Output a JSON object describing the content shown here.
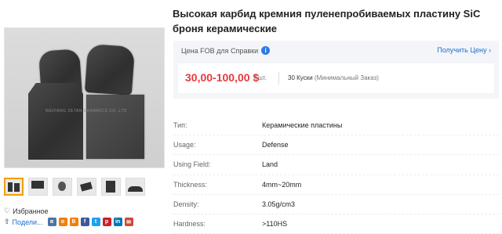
{
  "product": {
    "title": "Высокая карбид кремния пуленепробиваемых пластину SiC броня керамические",
    "image_watermark": "WEIFANG ZETAN CERAMICS CO.,LTD",
    "zoom_glyph": "⊕"
  },
  "price_box": {
    "header_label": "Цена FOB для Справки",
    "get_price_label": "Получить Цену",
    "price": "30,00-100,00 $",
    "unit": "/ шт.",
    "moq_value": "30 Куски",
    "moq_note": "(Минимальный Заказ)"
  },
  "specs": [
    {
      "key": "Тип:",
      "value": "Керамические пластины"
    },
    {
      "key": "Usage:",
      "value": "Defense"
    },
    {
      "key": "Using Field:",
      "value": "Land"
    },
    {
      "key": "Thickness:",
      "value": "4mm~20mm"
    },
    {
      "key": "Density:",
      "value": "3.05g/cm3"
    },
    {
      "key": "Hardness:",
      "value": ">110HS"
    }
  ],
  "actions": {
    "favorite_label": "Избранное",
    "share_label": "Подели...",
    "social_icons": [
      "vk-icon",
      "odnoklassniki-icon",
      "blogger-icon",
      "facebook-icon",
      "twitter-icon",
      "pinterest-icon",
      "linkedin-icon",
      "email-icon"
    ]
  },
  "colors": {
    "price": "#e4393c",
    "link": "#1a6fcf",
    "accent_thumb": "#f0a000",
    "info": "#2d7be5"
  }
}
